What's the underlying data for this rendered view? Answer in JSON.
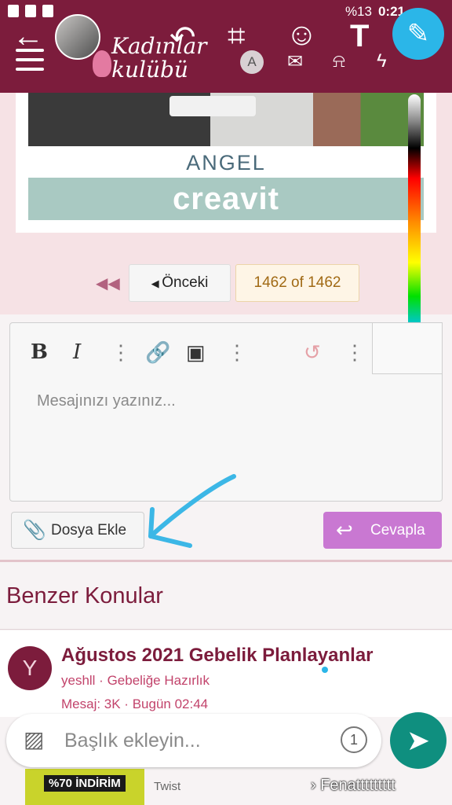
{
  "status_bar": {
    "network": "%13",
    "time": "0:21"
  },
  "header": {
    "logo_line1": "Kadınlar",
    "logo_line2": "kulübü",
    "avatar_letter": "A"
  },
  "editor_tools": {
    "back": "←",
    "undo": "↶",
    "crop": "⌗",
    "emoji": "☺",
    "text": "T",
    "pen": "✎"
  },
  "ad": {
    "brand": "ANGEL",
    "logo": "creavit"
  },
  "pagination": {
    "prev_label": "Önceki",
    "page_info": "1462 of 1462"
  },
  "composer": {
    "bold": "B",
    "italic": "I",
    "placeholder": "Mesajınızı yazınız...",
    "attach_label": "Dosya Ekle",
    "reply_label": "Cevapla"
  },
  "similar": {
    "title": "Benzer Konular",
    "threads": [
      {
        "avatar": "Y",
        "title": "Ağustos 2021 Gebelik Planlayanlar",
        "meta": "yeshll · Gebeliğe Hazırlık",
        "stats": "Mesaj: 3K · Bugün 02:44"
      }
    ]
  },
  "caption": {
    "placeholder": "Başlık ekleyin...",
    "timer": "1"
  },
  "bottom": {
    "ad_label": "%70 İNDİRİM",
    "label": "Twist",
    "footer": "› Fenattttttttt"
  },
  "colors": {
    "header": "#7c1c3c",
    "accent": "#c978d2",
    "send": "#0f8f7f",
    "pen": "#2bb6e8"
  }
}
